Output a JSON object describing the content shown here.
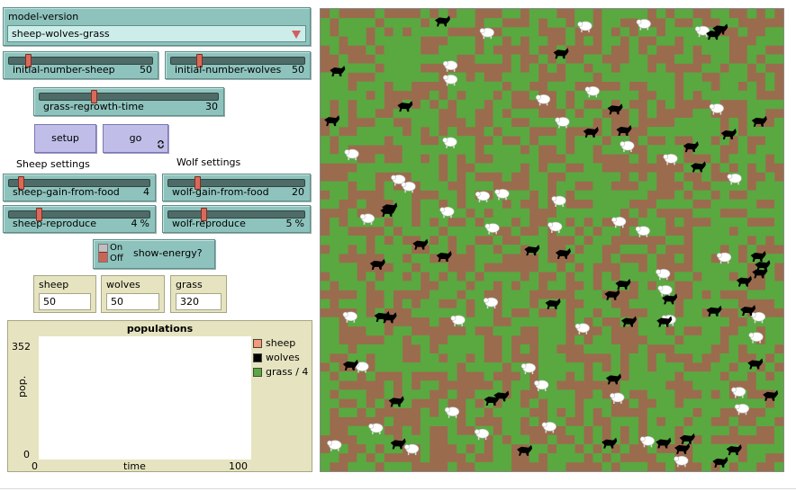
{
  "chooser": {
    "label": "model-version",
    "value": "sheep-wolves-grass",
    "options": [
      "sheep-wolves-grass"
    ]
  },
  "sliders": {
    "initial_number_sheep": {
      "label": "initial-number-sheep",
      "value": "50",
      "fraction": 0.12
    },
    "initial_number_wolves": {
      "label": "initial-number-wolves",
      "value": "50",
      "fraction": 0.2
    },
    "grass_regrowth_time": {
      "label": "grass-regrowth-time",
      "value": "30",
      "fraction": 0.3
    },
    "sheep_gain_from_food": {
      "label": "sheep-gain-from-food",
      "value": "4",
      "fraction": 0.07
    },
    "wolf_gain_from_food": {
      "label": "wolf-gain-from-food",
      "value": "20",
      "fraction": 0.2
    },
    "sheep_reproduce": {
      "label": "sheep-reproduce",
      "value": "4",
      "units": "%",
      "fraction": 0.2
    },
    "wolf_reproduce": {
      "label": "wolf-reproduce",
      "value": "5",
      "units": "%",
      "fraction": 0.25
    }
  },
  "buttons": {
    "setup": {
      "label": "setup"
    },
    "go": {
      "label": "go",
      "forever_icon": "forever-icon"
    }
  },
  "headings": {
    "sheep_settings": "Sheep settings",
    "wolf_settings": "Wolf settings"
  },
  "switch": {
    "on": "On",
    "off": "Off",
    "label": "show-energy?",
    "state": "off"
  },
  "monitors": [
    {
      "label": "sheep",
      "value": "50"
    },
    {
      "label": "wolves",
      "value": "50"
    },
    {
      "label": "grass",
      "value": "320"
    }
  ],
  "plot": {
    "title": "populations",
    "ylabel": "pop.",
    "xlabel": "time",
    "ymax": "352",
    "ymin": "0",
    "xmin": "0",
    "xmax": "100",
    "legend": [
      {
        "name": "sheep",
        "color": "#f49a78"
      },
      {
        "name": "wolves",
        "color": "#000000"
      },
      {
        "name": "grass / 4",
        "color": "#5aa840"
      }
    ]
  },
  "world": {
    "grass_color": "#5aa840",
    "dirt_color": "#9b6b4e",
    "sheep_color": "#ffffff",
    "wolf_color": "#000000"
  }
}
